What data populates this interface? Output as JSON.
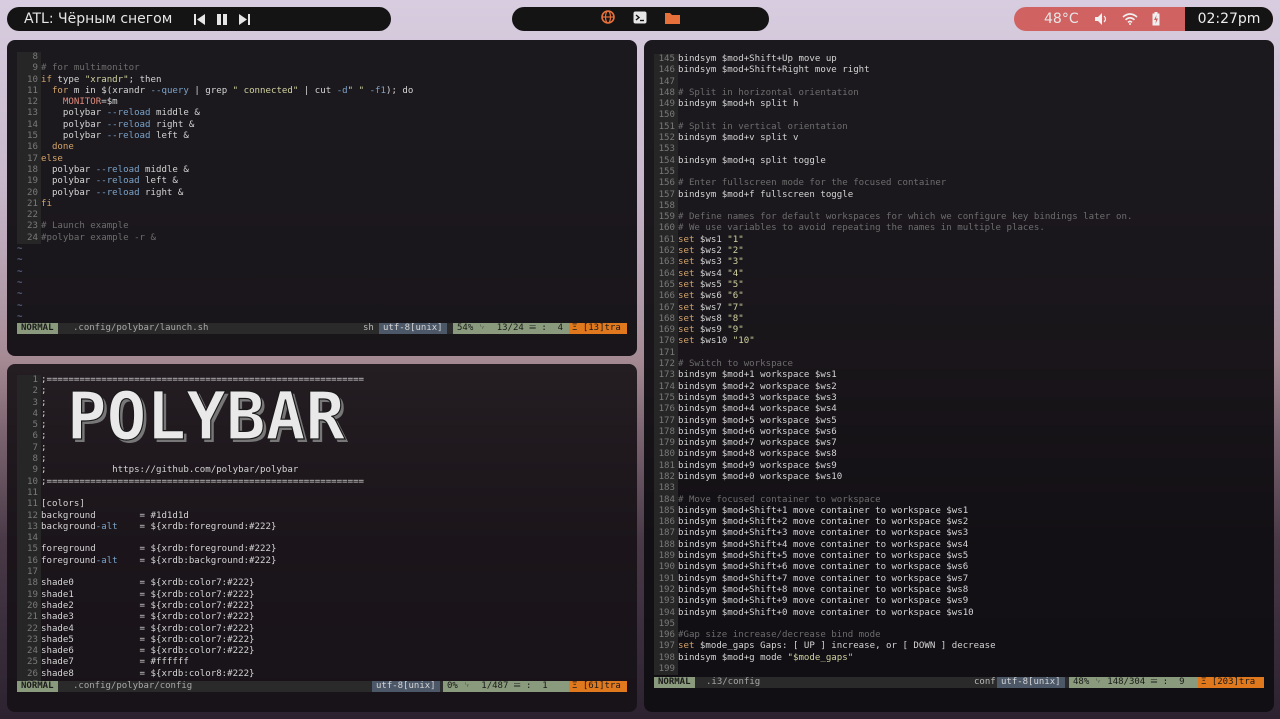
{
  "topbar": {
    "song": "ATL: Чёрным снегом",
    "temp": "48°C",
    "clock": "02:27pm"
  },
  "launch": {
    "lines": [
      [
        "8",
        ""
      ],
      [
        "9",
        "# for multimonitor"
      ],
      [
        "10",
        "if type \"xrandr\"; then"
      ],
      [
        "11",
        "  for m in $(xrandr --query | grep \" connected\" | cut -d\" \" -f1); do"
      ],
      [
        "12",
        "    MONITOR=$m"
      ],
      [
        "13",
        "    polybar --reload middle &"
      ],
      [
        "14",
        "    polybar --reload right &"
      ],
      [
        "15",
        "    polybar --reload left &"
      ],
      [
        "16",
        "  done"
      ],
      [
        "17",
        "else"
      ],
      [
        "18",
        "  polybar --reload middle &"
      ],
      [
        "19",
        "  polybar --reload left &"
      ],
      [
        "20",
        "  polybar --reload right &"
      ],
      [
        "21",
        "fi"
      ],
      [
        "22",
        ""
      ],
      [
        "23",
        "# Launch example"
      ],
      [
        "24",
        "#polybar example -r &"
      ]
    ],
    "tildes": 7,
    "status": {
      "mode": "NORMAL",
      "path": ".config/polybar/launch.sh",
      "ft": "sh",
      "enc": "utf-8[unix]",
      "pos": "54% ␊  13/24 ☰ :  4",
      "warn": "Ξ [13]tra"
    }
  },
  "config": {
    "lines": [
      [
        "1",
        ";=========================================================="
      ],
      [
        "2",
        ";"
      ],
      [
        "3",
        ";"
      ],
      [
        "4",
        ";"
      ],
      [
        "5",
        ";"
      ],
      [
        "6",
        ";"
      ],
      [
        "7",
        ";"
      ],
      [
        "8",
        ";"
      ],
      [
        "9",
        ";            https://github.com/polybar/polybar"
      ],
      [
        "10",
        ";=========================================================="
      ],
      [
        "11",
        ""
      ],
      [
        "11",
        "[colors]"
      ],
      [
        "12",
        "background        = #1d1d1d"
      ],
      [
        "13",
        "background-alt    = ${xrdb:foreground:#222}"
      ],
      [
        "14",
        ""
      ],
      [
        "15",
        "foreground        = ${xrdb:foreground:#222}"
      ],
      [
        "16",
        "foreground-alt    = ${xrdb:background:#222}"
      ],
      [
        "17",
        ""
      ],
      [
        "18",
        "shade0            = ${xrdb:color7:#222}"
      ],
      [
        "19",
        "shade1            = ${xrdb:color7:#222}"
      ],
      [
        "20",
        "shade2            = ${xrdb:color7:#222}"
      ],
      [
        "21",
        "shade3            = ${xrdb:color7:#222}"
      ],
      [
        "22",
        "shade4            = ${xrdb:color7:#222}"
      ],
      [
        "23",
        "shade5            = ${xrdb:color7:#222}"
      ],
      [
        "24",
        "shade6            = ${xrdb:color7:#222}"
      ],
      [
        "25",
        "shade7            = #ffffff"
      ],
      [
        "26",
        "shade8            = ${xrdb:color8:#222}"
      ],
      [
        "27",
        ""
      ]
    ],
    "logo_text": "POLYBAR",
    "status": {
      "mode": "NORMAL",
      "path": ".config/polybar/config",
      "enc": "utf-8[unix]",
      "pos": "0% ␊  1/487 ☰ :  1",
      "warn": "Ξ [61]tra"
    }
  },
  "i3": {
    "lines": [
      [
        "145",
        "bindsym $mod+Shift+Up move up"
      ],
      [
        "146",
        "bindsym $mod+Shift+Right move right"
      ],
      [
        "147",
        ""
      ],
      [
        "148",
        "# Split in horizontal orientation"
      ],
      [
        "149",
        "bindsym $mod+h split h"
      ],
      [
        "150",
        ""
      ],
      [
        "151",
        "# Split in vertical orientation"
      ],
      [
        "152",
        "bindsym $mod+v split v"
      ],
      [
        "153",
        ""
      ],
      [
        "154",
        "bindsym $mod+q split toggle"
      ],
      [
        "155",
        ""
      ],
      [
        "156",
        "# Enter fullscreen mode for the focused container"
      ],
      [
        "157",
        "bindsym $mod+f fullscreen toggle"
      ],
      [
        "158",
        ""
      ],
      [
        "159",
        "# Define names for default workspaces for which we configure key bindings later on."
      ],
      [
        "160",
        "# We use variables to avoid repeating the names in multiple places."
      ],
      [
        "161",
        "set $ws1 \"1\""
      ],
      [
        "162",
        "set $ws2 \"2\""
      ],
      [
        "163",
        "set $ws3 \"3\""
      ],
      [
        "164",
        "set $ws4 \"4\""
      ],
      [
        "165",
        "set $ws5 \"5\""
      ],
      [
        "166",
        "set $ws6 \"6\""
      ],
      [
        "167",
        "set $ws7 \"7\""
      ],
      [
        "168",
        "set $ws8 \"8\""
      ],
      [
        "169",
        "set $ws9 \"9\""
      ],
      [
        "170",
        "set $ws10 \"10\""
      ],
      [
        "171",
        ""
      ],
      [
        "172",
        "# Switch to workspace"
      ],
      [
        "173",
        "bindsym $mod+1 workspace $ws1"
      ],
      [
        "174",
        "bindsym $mod+2 workspace $ws2"
      ],
      [
        "175",
        "bindsym $mod+3 workspace $ws3"
      ],
      [
        "176",
        "bindsym $mod+4 workspace $ws4"
      ],
      [
        "177",
        "bindsym $mod+5 workspace $ws5"
      ],
      [
        "178",
        "bindsym $mod+6 workspace $ws6"
      ],
      [
        "179",
        "bindsym $mod+7 workspace $ws7"
      ],
      [
        "180",
        "bindsym $mod+8 workspace $ws8"
      ],
      [
        "181",
        "bindsym $mod+9 workspace $ws9"
      ],
      [
        "182",
        "bindsym $mod+0 workspace $ws10"
      ],
      [
        "183",
        ""
      ],
      [
        "184",
        "# Move focused container to workspace"
      ],
      [
        "185",
        "bindsym $mod+Shift+1 move container to workspace $ws1"
      ],
      [
        "186",
        "bindsym $mod+Shift+2 move container to workspace $ws2"
      ],
      [
        "187",
        "bindsym $mod+Shift+3 move container to workspace $ws3"
      ],
      [
        "188",
        "bindsym $mod+Shift+4 move container to workspace $ws4"
      ],
      [
        "189",
        "bindsym $mod+Shift+5 move container to workspace $ws5"
      ],
      [
        "190",
        "bindsym $mod+Shift+6 move container to workspace $ws6"
      ],
      [
        "191",
        "bindsym $mod+Shift+7 move container to workspace $ws7"
      ],
      [
        "192",
        "bindsym $mod+Shift+8 move container to workspace $ws8"
      ],
      [
        "193",
        "bindsym $mod+Shift+9 move container to workspace $ws9"
      ],
      [
        "194",
        "bindsym $mod+Shift+0 move container to workspace $ws10"
      ],
      [
        "195",
        ""
      ],
      [
        "196",
        "#Gap size increase/decrease bind mode"
      ],
      [
        "197",
        "set $mode_gaps Gaps: [ UP ] increase, or [ DOWN ] decrease"
      ],
      [
        "198",
        "bindsym $mod+g mode \"$mode_gaps\""
      ],
      [
        "199",
        ""
      ]
    ],
    "status": {
      "mode": "NORMAL",
      "path": ".i3/config",
      "ft": "conf",
      "enc": "utf-8[unix]",
      "pos": "48% ␊ 148/304 ☰ :  9",
      "warn": "Ξ [203]tra"
    }
  }
}
